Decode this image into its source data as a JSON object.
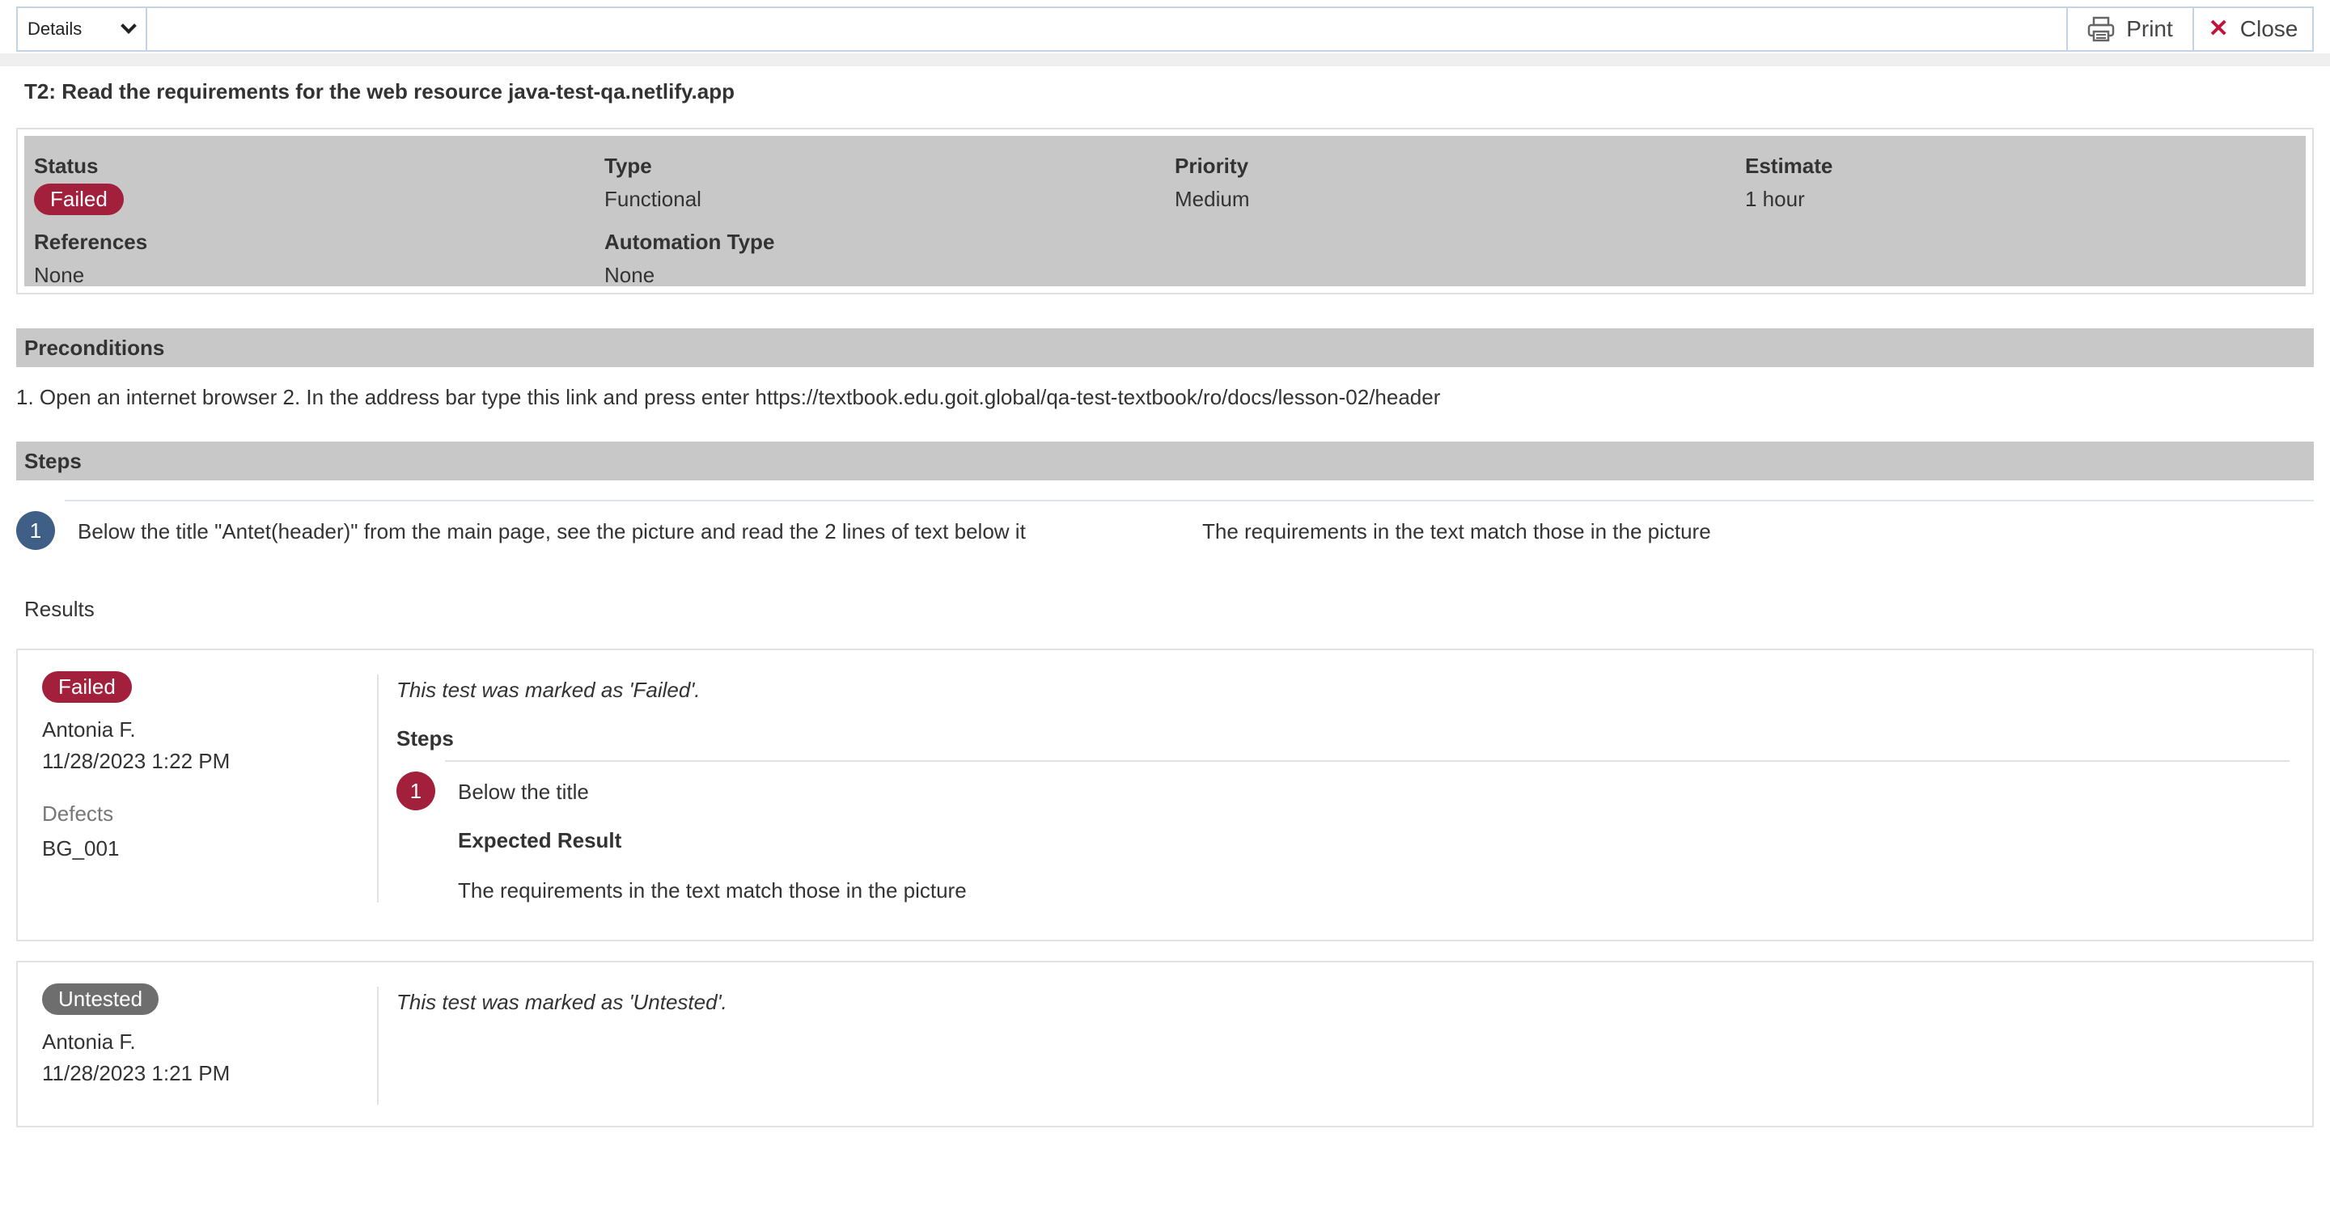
{
  "toolbar": {
    "view_select": "Details",
    "print_label": "Print",
    "close_label": "Close",
    "print_icon": "printer-icon",
    "close_icon": "close-icon"
  },
  "test": {
    "title": "T2: Read the requirements for the web resource java-test-qa.netlify.app",
    "fields": {
      "status_label": "Status",
      "status_value": "Failed",
      "type_label": "Type",
      "type_value": "Functional",
      "priority_label": "Priority",
      "priority_value": "Medium",
      "estimate_label": "Estimate",
      "estimate_value": "1 hour",
      "references_label": "References",
      "references_value": "None",
      "automation_label": "Automation Type",
      "automation_value": "None"
    },
    "status_color": "#a3203c"
  },
  "preconditions": {
    "heading": "Preconditions",
    "text": "1. Open an internet browser 2. In the address bar type this link and press enter https://textbook.edu.goit.global/qa-test-textbook/ro/docs/lesson-02/header"
  },
  "steps": {
    "heading": "Steps",
    "items": [
      {
        "number": "1",
        "content": "Below the title \"Antet(header)\" from the main page, see the picture and read the 2 lines of text below it",
        "expected": "The requirements in the text match those in the picture"
      }
    ]
  },
  "results": {
    "heading": "Results",
    "items": [
      {
        "status": "Failed",
        "user": "Antonia F.",
        "timestamp": "11/28/2023 1:22 PM",
        "defects_label": "Defects",
        "defects_value": "BG_001",
        "comment": "This test was marked as 'Failed'.",
        "steps_heading": "Steps",
        "step_number": "1",
        "step_content": "Below the title",
        "expected_label": "Expected Result",
        "expected_value": "The requirements in the text match those in the picture"
      },
      {
        "status": "Untested",
        "user": "Antonia F.",
        "timestamp": "11/28/2023 1:21 PM",
        "comment": "This test was marked as 'Untested'."
      }
    ]
  },
  "colors": {
    "failed": "#a3203c",
    "untested": "#6e6e6e",
    "step_blue": "#3f5f86",
    "section_bg": "#c8c8c8"
  }
}
